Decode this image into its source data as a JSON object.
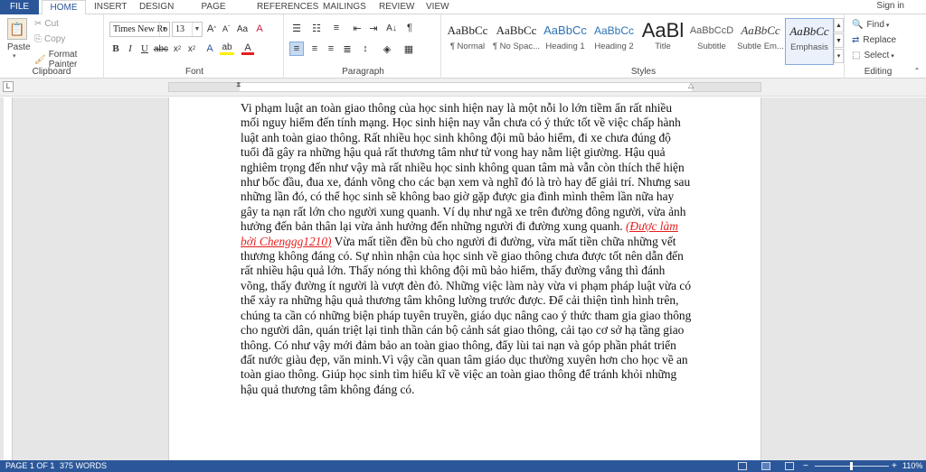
{
  "tabs": [
    "FILE",
    "HOME",
    "INSERT",
    "DESIGN",
    "PAGE LAYOUT",
    "REFERENCES",
    "MAILINGS",
    "REVIEW",
    "VIEW"
  ],
  "signin": "Sign in",
  "clipboard": {
    "paste": "Paste",
    "cut": "Cut",
    "copy": "Copy",
    "format_painter": "Format Painter",
    "label": "Clipboard"
  },
  "font": {
    "name": "Times New Ro",
    "size": "13",
    "label": "Font"
  },
  "paragraph": {
    "label": "Paragraph"
  },
  "styles": {
    "items": [
      {
        "preview": "AaBbCc",
        "name": "¶ Normal"
      },
      {
        "preview": "AaBbCc",
        "name": "¶ No Spac..."
      },
      {
        "preview": "AaBbCc",
        "name": "Heading 1"
      },
      {
        "preview": "AaBbCc",
        "name": "Heading 2"
      },
      {
        "preview": "AaBl",
        "name": "Title"
      },
      {
        "preview": "AaBbCcD",
        "name": "Subtitle"
      },
      {
        "preview": "AaBbCc",
        "name": "Subtle Em..."
      },
      {
        "preview": "AaBbCc",
        "name": "Emphasis"
      }
    ],
    "label": "Styles"
  },
  "editing": {
    "find": "Find",
    "replace": "Replace",
    "select": "Select",
    "label": "Editing"
  },
  "document": {
    "text_before": "Vi phạm luật an toàn giao thông của học sinh hiện nay là một nỗi lo lớn tiềm ẩn rất nhiều mối nguy hiểm đến tính mạng. Học sinh hiện nay vẫn chưa có ý thức tốt về việc chấp hành luật anh toàn giao thông. Rất nhiều học sinh không đội mũ bảo hiểm, đi xe chưa đúng độ tuổi đã gây ra những hậu quả rất thương tâm như tử vong hay nằm liệt giường. Hậu quả nghiêm trọng đến như vậy mà rất nhiều học sinh không quan tâm mà vẫn còn thích thể hiện như bốc đầu, đua xe, đánh võng cho các bạn xem và nghĩ đó là trò hay để giải trí. Nhưng sau những lần đó, có thể học sinh sẽ không bao giờ gặp được gia đình mình thêm lần nữa hay gây ta nạn rất lớn cho người xung quanh. Ví dụ như ngã xe trên đường đông người, vừa ảnh hưởng đến bản thân lại vừa ảnh hưởng đến những người đi đường xung quanh.",
    "credit": "(Được làm bởi Chenggg1210)",
    "text_after": "Vừa mất tiền đền bù cho người đi đường, vừa mất tiền chữa những vết thương không đáng có. Sự nhìn nhận của học sinh về giao thông chưa được tốt nên dẫn đến rất nhiều hậu quả lớn. Thấy nóng thì không đội mũ bảo hiểm, thấy đường vắng thì đánh võng, thấy đường ít người là vượt đèn đỏ. Những việc làm này vừa vi phạm pháp luật vừa có thể xảy ra những hậu quả thương tâm không lường trước được. Để cải thiện tình hình trên, chúng ta cần có những biện pháp tuyên truyền, giáo dục nâng cao ý thức tham gia giao thông cho người dân, quán triệt lại tinh thần cán bộ cảnh sát giao thông, cải tạo cơ sở hạ tầng giao thông. Có như vậy mới đảm bảo an toàn giao thông, đẩy lùi tai nạn và góp phần phát triển đất nước giàu đẹp, văn minh.Vì vậy cần quan tâm giáo dục thường xuyên hơn cho học về an toàn giao thông. Giúp học sinh tìm hiểu kĩ về việc an toàn giao thông để tránh khỏi những hậu quả thương tâm không đáng có."
  },
  "status": {
    "page": "PAGE 1 OF 1",
    "words": "375 WORDS",
    "zoom": "110%"
  },
  "colors": {
    "accent": "#2b579a",
    "credit": "#e51e1e"
  }
}
